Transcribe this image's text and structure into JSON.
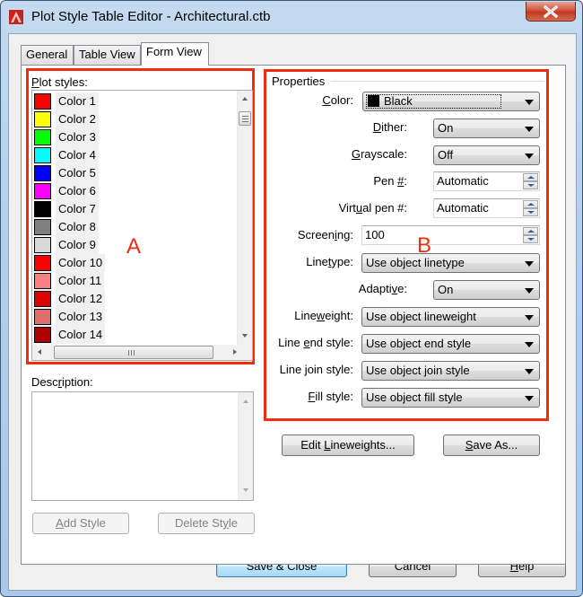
{
  "window": {
    "title": "Plot Style Table Editor - Architectural.ctb",
    "close_label": "X"
  },
  "tabs": [
    {
      "label": "General",
      "active": false
    },
    {
      "label": "Table View",
      "active": false
    },
    {
      "label": "Form View",
      "active": true
    }
  ],
  "plot_styles": {
    "label_mnemonic": "P",
    "label_rest": "lot styles:",
    "items": [
      {
        "label": "Color 1",
        "color": "#ff0000"
      },
      {
        "label": "Color 2",
        "color": "#ffff00"
      },
      {
        "label": "Color 3",
        "color": "#00ff00"
      },
      {
        "label": "Color 4",
        "color": "#00ffff"
      },
      {
        "label": "Color 5",
        "color": "#0000ff"
      },
      {
        "label": "Color 6",
        "color": "#ff00ff"
      },
      {
        "label": "Color 7",
        "color": "#000000"
      },
      {
        "label": "Color 8",
        "color": "#808080"
      },
      {
        "label": "Color 9",
        "color": "#d9d9d9"
      },
      {
        "label": "Color 10",
        "color": "#ff0000"
      },
      {
        "label": "Color 11",
        "color": "#ff8080"
      },
      {
        "label": "Color 12",
        "color": "#dd0000"
      },
      {
        "label": "Color 13",
        "color": "#dd7070"
      },
      {
        "label": "Color 14",
        "color": "#b00000"
      }
    ]
  },
  "description": {
    "label_pre": "Desc",
    "label_mnemonic": "r",
    "label_post": "iption:",
    "value": ""
  },
  "left_buttons": {
    "add_style_mnemonic": "A",
    "add_style_rest": "dd Style",
    "delete_style_pre": "Delete St",
    "delete_style_mnemonic": "y",
    "delete_style_post": "le"
  },
  "properties": {
    "group_label": "Properties",
    "color": {
      "label_mnemonic": "C",
      "label_rest": "olor:",
      "value": "Black",
      "swatch": "#000000"
    },
    "dither": {
      "label_mnemonic": "D",
      "label_rest": "ither:",
      "value": "On"
    },
    "grayscale": {
      "label_mnemonic": "G",
      "label_rest": "rayscale:",
      "value": "Off"
    },
    "pen": {
      "label_pre": "Pen ",
      "label_mnemonic": "#",
      "label_post": ":",
      "value": "Automatic"
    },
    "virtual_pen": {
      "label_pre": "Virt",
      "label_mnemonic": "u",
      "label_post": "al pen #:",
      "value": "Automatic"
    },
    "screening": {
      "label_pre": "Screen",
      "label_mnemonic": "i",
      "label_post": "ng:",
      "value": "100"
    },
    "linetype": {
      "label_pre": "Line",
      "label_mnemonic": "t",
      "label_post": "ype:",
      "value": "Use object linetype"
    },
    "adaptive": {
      "label_pre": "Adapti",
      "label_mnemonic": "v",
      "label_post": "e:",
      "value": "On"
    },
    "lineweight": {
      "label_pre": "Line",
      "label_mnemonic": "w",
      "label_post": "eight:",
      "value": "Use object lineweight"
    },
    "line_end_style": {
      "label_pre": "Line ",
      "label_mnemonic": "e",
      "label_post": "nd style:",
      "value": "Use object end style"
    },
    "line_join_style": {
      "label_pre": "Line ",
      "label_mnemonic": "j",
      "label_post": "oin style:",
      "value": "Use object join style"
    },
    "fill_style": {
      "label_mnemonic": "F",
      "label_rest": "ill style:",
      "value": "Use object fill style"
    }
  },
  "right_buttons": {
    "edit_lineweights_pre": "Edit ",
    "edit_lineweights_mnemonic": "L",
    "edit_lineweights_post": "ineweights...",
    "save_as_mnemonic": "S",
    "save_as_rest": "ave As..."
  },
  "footer": {
    "save_close": "Save & Close",
    "cancel": "Cancel",
    "help_mnemonic": "H",
    "help_rest": "elp"
  },
  "annotations": {
    "a": "A",
    "b": "B",
    "color": "#f02d0f"
  }
}
